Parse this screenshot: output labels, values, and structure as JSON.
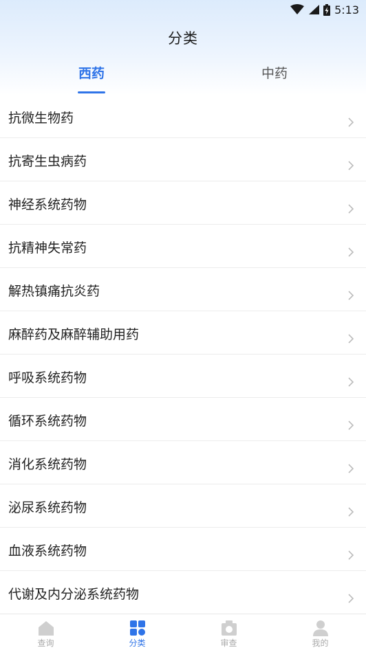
{
  "status": {
    "time": "5:13"
  },
  "header": {
    "title": "分类"
  },
  "tabs": [
    {
      "label": "西药",
      "active": true
    },
    {
      "label": "中药",
      "active": false
    }
  ],
  "categories": [
    "抗微生物药",
    "抗寄生虫病药",
    "神经系统药物",
    "抗精神失常药",
    "解热镇痛抗炎药",
    "麻醉药及麻醉辅助用药",
    "呼吸系统药物",
    "循环系统药物",
    "消化系统药物",
    "泌尿系统药物",
    "血液系统药物",
    "代谢及内分泌系统药物"
  ],
  "bottom_nav": [
    {
      "label": "查询",
      "icon": "home-icon",
      "active": false
    },
    {
      "label": "分类",
      "icon": "grid-icon",
      "active": true
    },
    {
      "label": "审查",
      "icon": "camera-icon",
      "active": false
    },
    {
      "label": "我的",
      "icon": "user-icon",
      "active": false
    }
  ],
  "colors": {
    "accent": "#2f74e8",
    "inactive": "#aaaaaa",
    "header_bg": "#dcebfc"
  }
}
